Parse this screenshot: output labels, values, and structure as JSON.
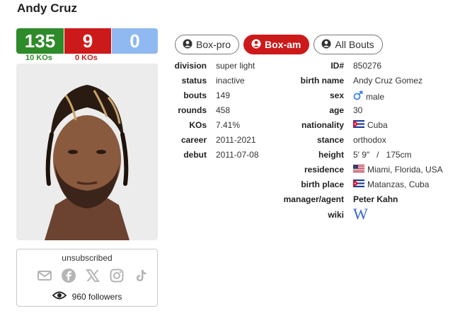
{
  "boxer": {
    "name": "Andy Cruz"
  },
  "record": {
    "wins": "135",
    "losses": "9",
    "draws": "0",
    "win_kos": "10 KOs",
    "loss_kos": "0 KOs"
  },
  "tabs": [
    {
      "label": "Box-pro",
      "active": false
    },
    {
      "label": "Box-am",
      "active": true
    },
    {
      "label": "All Bouts",
      "active": false
    }
  ],
  "left_stats": [
    {
      "label": "division",
      "value": "super light"
    },
    {
      "label": "status",
      "value": "inactive"
    },
    {
      "label": "bouts",
      "value": "149"
    },
    {
      "label": "rounds",
      "value": "458"
    },
    {
      "label": "KOs",
      "value": "7.41%"
    },
    {
      "label": "career",
      "value": "2011-2021"
    },
    {
      "label": "debut",
      "value": "2011-07-08"
    }
  ],
  "right_stats": [
    {
      "label": "ID#",
      "value": "850276"
    },
    {
      "label": "birth name",
      "value": "Andy Cruz Gomez"
    },
    {
      "label": "sex",
      "value": "male",
      "icon": "male-icon"
    },
    {
      "label": "age",
      "value": "30"
    },
    {
      "label": "nationality",
      "value": "Cuba",
      "icon": "cuba-flag-icon"
    },
    {
      "label": "stance",
      "value": "orthodox"
    },
    {
      "label": "height",
      "value": "5′ 9″   /   175cm"
    },
    {
      "label": "residence",
      "value": "Miami, Florida, USA",
      "icon": "usa-flag-icon"
    },
    {
      "label": "birth place",
      "value": "Matanzas, Cuba",
      "icon": "cuba-flag-icon"
    },
    {
      "label": "manager/agent",
      "value": "Peter Kahn"
    },
    {
      "label": "wiki",
      "value": "",
      "icon": "wikipedia-icon"
    }
  ],
  "social": {
    "status": "unsubscribed",
    "followers": "960 followers",
    "icons": [
      "email-icon",
      "facebook-icon",
      "x-icon",
      "instagram-icon",
      "tiktok-icon"
    ]
  },
  "colors": {
    "win": "#2e8b2a",
    "loss": "#cc1a1a",
    "draw": "#8fb9f0",
    "wiki": "#3366cc",
    "male": "#3b82f6"
  }
}
